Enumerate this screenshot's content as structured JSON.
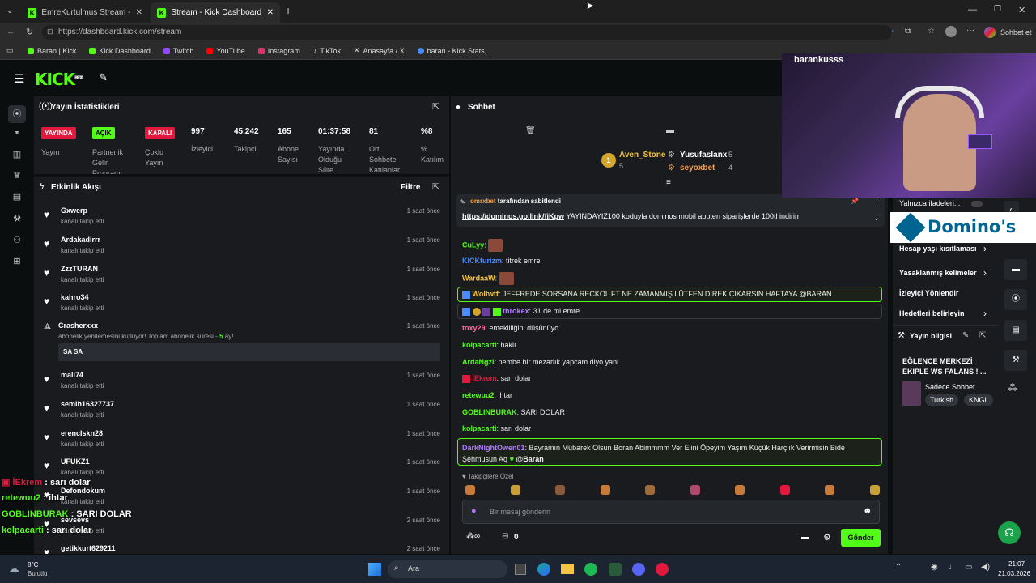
{
  "browser": {
    "tabs": [
      {
        "label": "EmreKurtulmus Stream - Watch Li"
      },
      {
        "label": "Stream - Kick Dashboard"
      }
    ],
    "url": "https://dashboard.kick.com/stream",
    "bookmarks": [
      {
        "label": "Baran | Kick",
        "color": "#53fc18"
      },
      {
        "label": "Kick Dashboard",
        "color": "#53fc18"
      },
      {
        "label": "Twitch",
        "color": "#9146ff"
      },
      {
        "label": "YouTube",
        "color": "#ff0000"
      },
      {
        "label": "Instagram",
        "color": "#e1306c"
      },
      {
        "label": "TikTok",
        "color": "#ffffff"
      },
      {
        "label": "Anasayfa / X",
        "color": "#ffffff"
      },
      {
        "label": "baran - Kick Stats,...",
        "color": "#4a8cff"
      }
    ],
    "chat_button": "Sohbet et"
  },
  "kick": {
    "logo": "KICK",
    "logo_sup": "BETA",
    "stats": {
      "title": "Yayın İstatistikleri",
      "badges": [
        {
          "value": "YAYINDA",
          "label": "Yayın",
          "color": "#e2193d"
        },
        {
          "value": "AÇIK",
          "label": "Partnerlik Gelir Programı",
          "color": "#53fc18"
        },
        {
          "value": "KAPALI",
          "label": "Çoklu Yayın",
          "color": "#e2193d"
        }
      ],
      "metrics": [
        {
          "value": "997",
          "label": "İzleyici"
        },
        {
          "value": "45.242",
          "label": "Takipçi"
        },
        {
          "value": "165",
          "label": "Abone Sayısı"
        },
        {
          "value": "01:37:58",
          "label": "Yayında Olduğu Süre"
        },
        {
          "value": "81",
          "label": "Ort. Sohbete Katılanlar"
        },
        {
          "value": "%8",
          "label": "% Katılım"
        }
      ]
    },
    "events": {
      "title": "Etkinlik Akışı",
      "filter": "Filtre",
      "items": [
        {
          "name": "Gxwerp",
          "sub": "kanalı takip etti",
          "time": "1 saat önce"
        },
        {
          "name": "Ardakadirrr",
          "sub": "kanalı takip etti",
          "time": "1 saat önce"
        },
        {
          "name": "ZzzTURAN",
          "sub": "kanalı takip etti",
          "time": "1 saat önce"
        },
        {
          "name": "kahro34",
          "sub": "kanalı takip etti",
          "time": "1 saat önce"
        }
      ],
      "sub_event": {
        "name": "Crasherxxx",
        "text": "abonelik yenilemesini kutluyor! Toplam abonelik süresi - ",
        "months": "5",
        "suffix": " ay!",
        "message": "SA SA",
        "time": "1 saat önce"
      },
      "items2": [
        {
          "name": "mali74",
          "sub": "kanalı takip etti",
          "time": "1 saat önce"
        },
        {
          "name": "semih16327737",
          "sub": "kanalı takip etti",
          "time": "1 saat önce"
        },
        {
          "name": "erenclskn28",
          "sub": "kanalı takip etti",
          "time": "1 saat önce"
        },
        {
          "name": "UFUKZ1",
          "sub": "kanalı takip etti",
          "time": "1 saat önce"
        },
        {
          "name": "Defondokum",
          "sub": "kanalı takip etti",
          "time": "1 saat önce"
        },
        {
          "name": "sevsevs",
          "sub": "kanalı takip etti",
          "time": "2 saat önce"
        },
        {
          "name": "getikkurt629211",
          "sub": "",
          "time": "2 saat önce"
        }
      ]
    },
    "chat": {
      "title": "Sohbet",
      "leaders": [
        {
          "rank": "1",
          "name": "Aven_Stone",
          "count": "5"
        },
        {
          "rank": "",
          "name": "Yusufaslanx",
          "count": "5"
        },
        {
          "rank": "",
          "name": "seyoxbet",
          "count": "4"
        }
      ],
      "pinned_by": "omrxbet",
      "pinned_by_suffix": "tarafından sabitlendi",
      "pinned_link": "https://dominos.go.link/fiKpw",
      "pinned_text": "YAYINDAYIZ100 koduyla dominos mobil appten siparişlerde 100tl indirim",
      "messages": [
        {
          "user": "CuLyy",
          "text": "",
          "color": "#53fc18"
        },
        {
          "user": "KICKturizm",
          "text": "titrek emre",
          "color": "#4a8cff"
        },
        {
          "user": "WardaaW",
          "text": "",
          "color": "#f5c542"
        },
        {
          "user": "Woltwtf",
          "text": "JEFFREDE SORSANA RECKOL FT NE ZAMANMIŞ LÜTFEN DİREK ÇIKARSIN HAFTAYA @BARAN",
          "color": "#f5c542"
        },
        {
          "user": "throkex",
          "text": "31 de mi emre",
          "color": "#b07cff"
        },
        {
          "user": "toxy29",
          "text": "emekliliğini düşünüyo",
          "color": "#ff6b9a"
        },
        {
          "user": "kolpacarti",
          "text": "haklı",
          "color": "#53fc18"
        },
        {
          "user": "ArdaNgzl",
          "text": "pembe bir mezarlık yapcam diyo yani",
          "color": "#53fc18"
        },
        {
          "user": "İEkrem",
          "text": "sarı dolar",
          "color": "#e2193d"
        },
        {
          "user": "retewuu2",
          "text": "ihtar",
          "color": "#53fc18"
        },
        {
          "user": "GOBLINBURAK",
          "text": "SARI DOLAR",
          "color": "#53fc18"
        },
        {
          "user": "kolpacarti",
          "text": "sarı dolar",
          "color": "#53fc18"
        },
        {
          "user": "DarkNightOwen01",
          "text": "Bayramın Mübarek Olsun Boran Abimmmm Ver Elini Öpeyim Yaşım Küçük Harçlık Verirmisin Bide Şehmusun Aq",
          "mention": "@Baran",
          "color": "#b07cff"
        }
      ],
      "follower_only": "Takipçilere Özel",
      "input_placeholder": "Bir mesaj gönderin",
      "points": "0",
      "send_label": "Gönder"
    },
    "sidebar": {
      "items": [
        {
          "label": "Yalnızca ifadeleri..."
        },
        {
          "label": "Hesap yaşı kısıtlaması"
        },
        {
          "label": "Yasaklanmış kelimeler"
        },
        {
          "label": "İzleyici Yönlendir"
        },
        {
          "label": "Hedefleri belirleyin"
        }
      ],
      "stream_info_title": "Yayın bilgisi",
      "stream_title": "EĞLENCE MERKEZİ EKİPLE WS FALANS ! ...",
      "category": "Sadece Sohbet",
      "tags": [
        "Turkish",
        "KNGL"
      ]
    },
    "webcam_name": "barankusss",
    "dominos": "Domino's"
  },
  "overlay_chat": [
    {
      "user": "İEkrem",
      "text": ": sarı dolar",
      "color": "#e2193d"
    },
    {
      "user": "retewuu2",
      "text": ": ihtar",
      "color": "#53fc18"
    },
    {
      "user": "GOBLINBURAK",
      "text": ": SARI DOLAR",
      "color": "#53fc18"
    },
    {
      "user": "kolpacarti",
      "text": ": sarı dolar",
      "color": "#53fc18"
    }
  ],
  "taskbar": {
    "weather_temp": "8°C",
    "weather_text": "Bulutlu",
    "search": "Ara",
    "time": "21:07",
    "date": "21.03.2026"
  }
}
